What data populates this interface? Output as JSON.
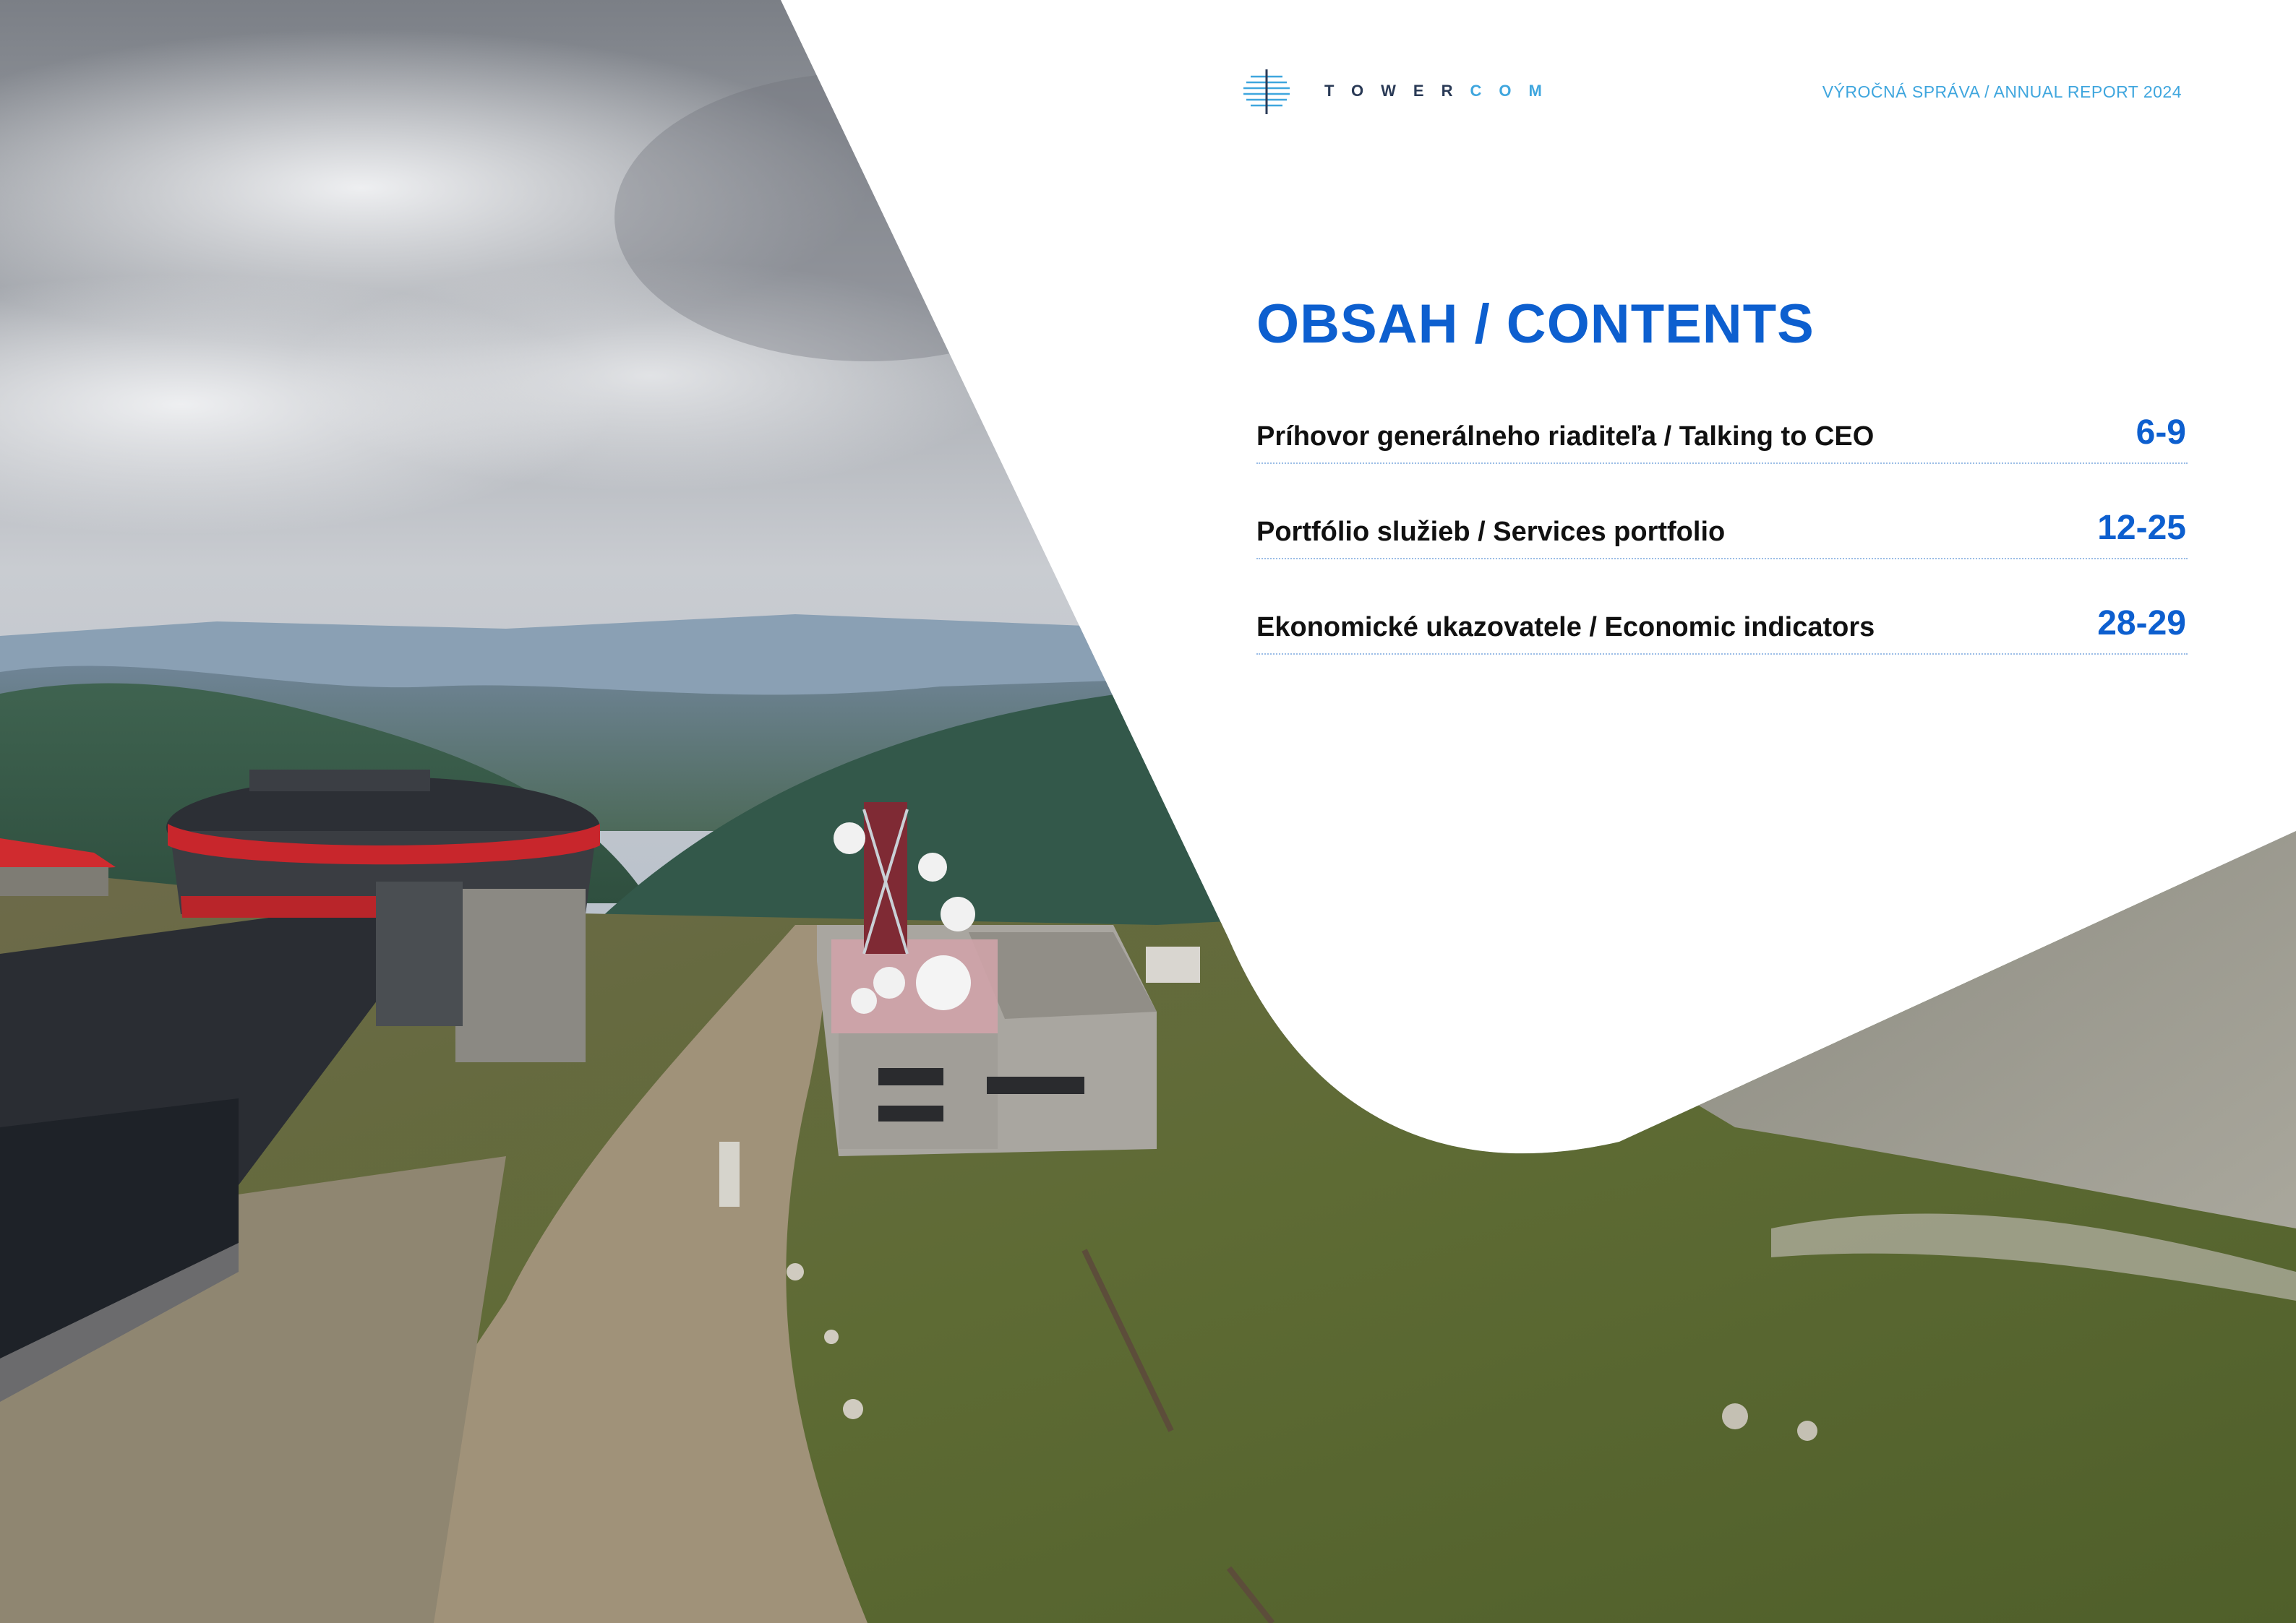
{
  "brand": {
    "logo_part1": "TOWER",
    "logo_part2": "COM",
    "accent": "#3fa6de",
    "primary": "#0d5fcf"
  },
  "header": {
    "report_title": "VÝROČNÁ SPRÁVA / ANNUAL REPORT 2024"
  },
  "contents": {
    "title": "OBSAH / CONTENTS",
    "items": [
      {
        "label": "Príhovor generálneho riaditeľa / Talking to CEO",
        "pages": "6-9"
      },
      {
        "label": "Portfólio služieb / Services portfolio",
        "pages": "12-25"
      },
      {
        "label": "Ekonomické ukazovatele / Economic indicators",
        "pages": "28-29"
      }
    ]
  },
  "photo": {
    "subject": "mountain-summit-transmitter-station"
  }
}
